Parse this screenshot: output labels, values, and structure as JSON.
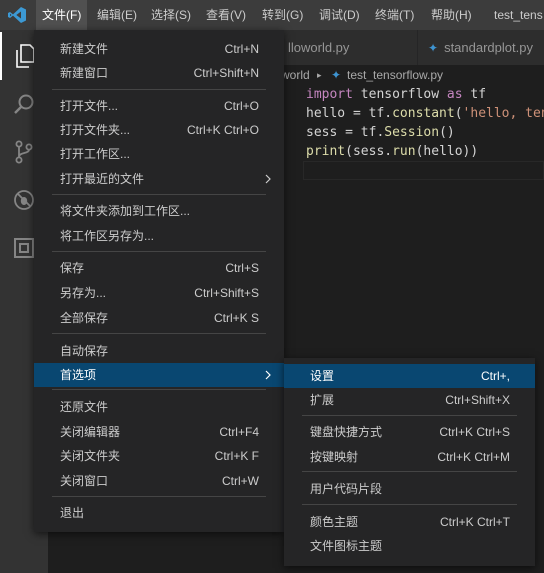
{
  "menubar": {
    "items": [
      "文件(F)",
      "编辑(E)",
      "选择(S)",
      "查看(V)",
      "转到(G)",
      "调试(D)",
      "终端(T)",
      "帮助(H)"
    ],
    "window_title": "test_tens"
  },
  "tabs": [
    "lloworld.py",
    "standardplot.py"
  ],
  "breadcrumb": {
    "folder": "world",
    "file": "test_tensorflow.py"
  },
  "code": [
    [
      {
        "t": "import",
        "c": "kw"
      },
      {
        "t": " tensorflow "
      },
      {
        "t": "as",
        "c": "kw"
      },
      {
        "t": " tf"
      }
    ],
    [
      {
        "t": "hello = tf."
      },
      {
        "t": "constant",
        "c": "fn"
      },
      {
        "t": "("
      },
      {
        "t": "'hello, tens",
        "c": "str"
      }
    ],
    [
      {
        "t": "sess = tf."
      },
      {
        "t": "Session",
        "c": "fn"
      },
      {
        "t": "()"
      }
    ],
    [
      {
        "t": "print",
        "c": "fn"
      },
      {
        "t": "(sess."
      },
      {
        "t": "run",
        "c": "fn"
      },
      {
        "t": "(hello))"
      }
    ]
  ],
  "file_menu": {
    "items": [
      {
        "label": "新建文件",
        "shortcut": "Ctrl+N"
      },
      {
        "label": "新建窗口",
        "shortcut": "Ctrl+Shift+N"
      },
      {
        "label": "打开文件...",
        "shortcut": "Ctrl+O"
      },
      {
        "label": "打开文件夹...",
        "shortcut": "Ctrl+K Ctrl+O"
      },
      {
        "label": "打开工作区...",
        "shortcut": ""
      },
      {
        "label": "打开最近的文件",
        "shortcut": "",
        "submenu": true
      },
      {
        "label": "将文件夹添加到工作区...",
        "shortcut": ""
      },
      {
        "label": "将工作区另存为...",
        "shortcut": ""
      },
      {
        "label": "保存",
        "shortcut": "Ctrl+S"
      },
      {
        "label": "另存为...",
        "shortcut": "Ctrl+Shift+S"
      },
      {
        "label": "全部保存",
        "shortcut": "Ctrl+K S"
      },
      {
        "label": "自动保存",
        "shortcut": ""
      },
      {
        "label": "首选项",
        "shortcut": "",
        "submenu": true,
        "selected": true
      },
      {
        "label": "还原文件",
        "shortcut": ""
      },
      {
        "label": "关闭编辑器",
        "shortcut": "Ctrl+F4"
      },
      {
        "label": "关闭文件夹",
        "shortcut": "Ctrl+K F"
      },
      {
        "label": "关闭窗口",
        "shortcut": "Ctrl+W"
      },
      {
        "label": "退出",
        "shortcut": ""
      }
    ]
  },
  "preferences_menu": {
    "items": [
      {
        "label": "设置",
        "shortcut": "Ctrl+,",
        "selected": true
      },
      {
        "label": "扩展",
        "shortcut": "Ctrl+Shift+X"
      },
      {
        "label": "键盘快捷方式",
        "shortcut": "Ctrl+K Ctrl+S"
      },
      {
        "label": "按键映射",
        "shortcut": "Ctrl+K Ctrl+M"
      },
      {
        "label": "用户代码片段",
        "shortcut": ""
      },
      {
        "label": "颜色主题",
        "shortcut": "Ctrl+K Ctrl+T"
      },
      {
        "label": "文件图标主题",
        "shortcut": ""
      }
    ]
  },
  "activity_icons": [
    "explorer-icon",
    "search-icon",
    "source-control-icon",
    "debug-icon",
    "extensions-icon"
  ],
  "colors": {
    "menubar_bg": "#3c3c3c",
    "menu_bg": "#252526",
    "selection": "#094771",
    "activity_bar_bg": "#333333",
    "editor_bg": "#1e1e1e",
    "python_icon": "#3e94d1"
  }
}
